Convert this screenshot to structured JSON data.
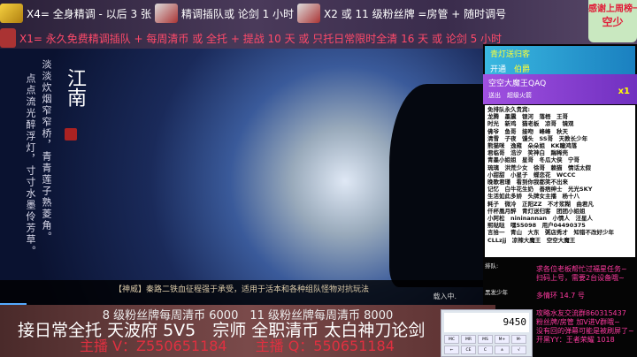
{
  "top": {
    "line1": [
      "X4= 全身精调 - 以后 3 张",
      "精调插队或 论剑 1 小时",
      "X2 或 11 级粉丝牌 =房管 + 随时调号"
    ],
    "line2": "X1= 永久免费精调插队 + 每周清币 或 全托 + 提战 10 天 或 只托日常限时全清 16 天 或 论剑 5 小时",
    "thanks": [
      "感谢上周榜一老板",
      "空少"
    ]
  },
  "game": {
    "title": "江南",
    "poem": [
      "淡淡炊烟窄窄桥，青青莲子熟菱角。",
      "点点流光醉浮灯，寸寸水墨伶芳草。"
    ],
    "tip": "【神威】秦路二铁血征程强于承受，适用于活本和各种组队怪物对抗玩法",
    "loading": "载入中."
  },
  "cards": [
    {
      "name": "青灯送归客",
      "action": "开通",
      "item": "伯爵"
    },
    {
      "name": "空空大魔王QAQ",
      "action": "送出",
      "item": "超级火箭",
      "count": "x1"
    }
  ],
  "list": {
    "title": "免排队永久贵宾:",
    "rows": [
      "龙腾　墨震　银河　落梧　王哥",
      "时光　新鸡　猫老板　凉哥　镜观",
      "佛爷　鱼哥　接吻　峰峰　秋天",
      "清雪　子夜　馒头　SS哥　天教长少年",
      "熊猫咪　逸雍　朵朵姐　KK瞳鸿落",
      "君临哥　浩汐　笑神白　踹稀壳",
      "青墨小姐姐　星哥　冬瓜大侠　宁哥",
      "琉璃　洪荒少女　徐哥　赖猫　情话太假",
      "小甜甜　小星子　蝶恋花　WCCC",
      "晚歌君瑾　看到你我都笑不出来",
      "记忆　白牛花生奶　善痞绅士　光光SKY",
      "生活如此多娇　头牌女主播　杨十八",
      "耗子　微冷　正阳ZZ　不才浆糊　曲君凡",
      "仟杯凰月醉　青灯送归客　团团小姐姐",
      "小阿松　nininannan　小情人　汪星人",
      "熙哒哒　嘿55098　用户04490375",
      "言拾一　青山　大东　粥店秀才　知错不改好少年",
      "CLLzjj　凉辣大魔王　空空大魔王"
    ],
    "queue": "排队:",
    "extra": "黑发少年"
  },
  "notes": [
    "求各位老板帮忙过福星任务~",
    "扫码上号，需要2台设备哦~",
    "",
    "多情环 14.7 号",
    "",
    "攻略水友交流群860315437",
    "粉丝牌/房管 加V进V群哦~",
    "没有回的弹幕可能是被刷屏了~",
    "开黑YY：王者荣耀 1018"
  ],
  "bottom": {
    "line1": "8 级粉丝牌每周清币 6000　11 级粉丝牌每周清币 8000",
    "line2": "接日常全托 天波府 5V5　宗师 全职清币 太白神刀论剑",
    "line3": "主播 V：Z550651184　　主播 Q：550651184"
  },
  "calculator": {
    "display": "9450",
    "keys": [
      "MC",
      "MR",
      "MS",
      "M+",
      "M-",
      "←",
      "CE",
      "C",
      "±",
      "√"
    ]
  }
}
